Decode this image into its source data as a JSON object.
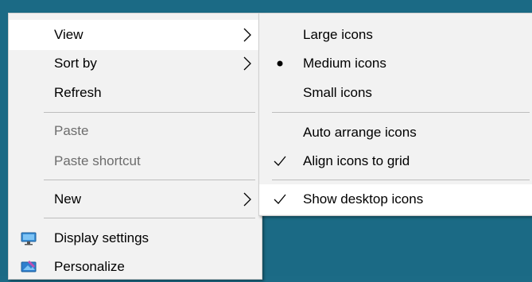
{
  "context_menu": {
    "items": [
      {
        "label": "View",
        "submenu": true,
        "highlighted": true
      },
      {
        "label": "Sort by",
        "submenu": true
      },
      {
        "label": "Refresh"
      },
      {
        "label": "Paste",
        "disabled": true
      },
      {
        "label": "Paste shortcut",
        "disabled": true
      },
      {
        "label": "New",
        "submenu": true
      },
      {
        "label": "Display settings",
        "icon": "display-settings-icon"
      },
      {
        "label": "Personalize",
        "icon": "personalize-icon"
      }
    ]
  },
  "view_submenu": {
    "items": [
      {
        "label": "Large icons"
      },
      {
        "label": "Medium icons",
        "selected": true,
        "marker": "bullet"
      },
      {
        "label": "Small icons"
      },
      {
        "label": "Auto arrange icons"
      },
      {
        "label": "Align icons to grid",
        "checked": true,
        "marker": "check"
      },
      {
        "label": "Show desktop icons",
        "checked": true,
        "marker": "check",
        "highlighted": true
      }
    ]
  },
  "colors": {
    "desktop_bg": "#1b6a85",
    "menu_bg": "#f2f2f2",
    "hover_bg": "#ffffff",
    "disabled_text": "#6d6d6d"
  }
}
